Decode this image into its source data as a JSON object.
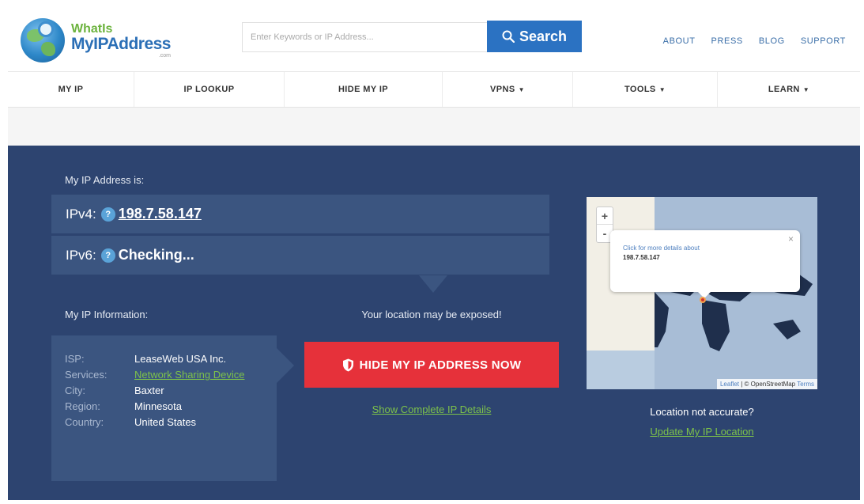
{
  "brand": {
    "line1": "WhatIs",
    "line2": "MyIPAddress",
    "line3": ".com"
  },
  "search": {
    "placeholder": "Enter Keywords or IP Address...",
    "button_label": "Search"
  },
  "top_links": [
    "ABOUT",
    "PRESS",
    "BLOG",
    "SUPPORT"
  ],
  "nav": [
    {
      "label": "MY IP",
      "dropdown": false
    },
    {
      "label": "IP LOOKUP",
      "dropdown": false
    },
    {
      "label": "HIDE MY IP",
      "dropdown": false
    },
    {
      "label": "VPNS",
      "dropdown": true
    },
    {
      "label": "TOOLS",
      "dropdown": true
    },
    {
      "label": "LEARN",
      "dropdown": true
    }
  ],
  "main": {
    "ip_label": "My IP Address is:",
    "ipv4_label": "IPv4:",
    "ipv4_value": "198.7.58.147",
    "ipv6_label": "IPv6:",
    "ipv6_value": "Checking...",
    "help_glyph": "?",
    "info_label": "My IP Information:",
    "info": {
      "isp_key": "ISP:",
      "isp_val": "LeaseWeb USA Inc.",
      "services_key": "Services:",
      "services_val": "Network Sharing Device",
      "city_key": "City:",
      "city_val": "Baxter",
      "region_key": "Region:",
      "region_val": "Minnesota",
      "country_key": "Country:",
      "country_val": "United States"
    },
    "exposed_text": "Your location may be exposed!",
    "hide_button": "HIDE MY IP ADDRESS NOW",
    "show_details": "Show Complete IP Details",
    "map": {
      "zoom_in": "+",
      "zoom_out": "-",
      "popup_text": "Click for more details about",
      "popup_ip": "198.7.58.147",
      "popup_close": "×",
      "attr_leaflet": "Leaflet",
      "attr_sep": " | © OpenStreetMap ",
      "attr_terms": "Terms"
    },
    "location_question": "Location not accurate?",
    "update_link": "Update My IP Location"
  },
  "colors": {
    "accent_blue": "#2b72c2",
    "panel_bg": "#2d4470",
    "danger_red": "#e6313a",
    "link_green": "#7dc24a"
  }
}
